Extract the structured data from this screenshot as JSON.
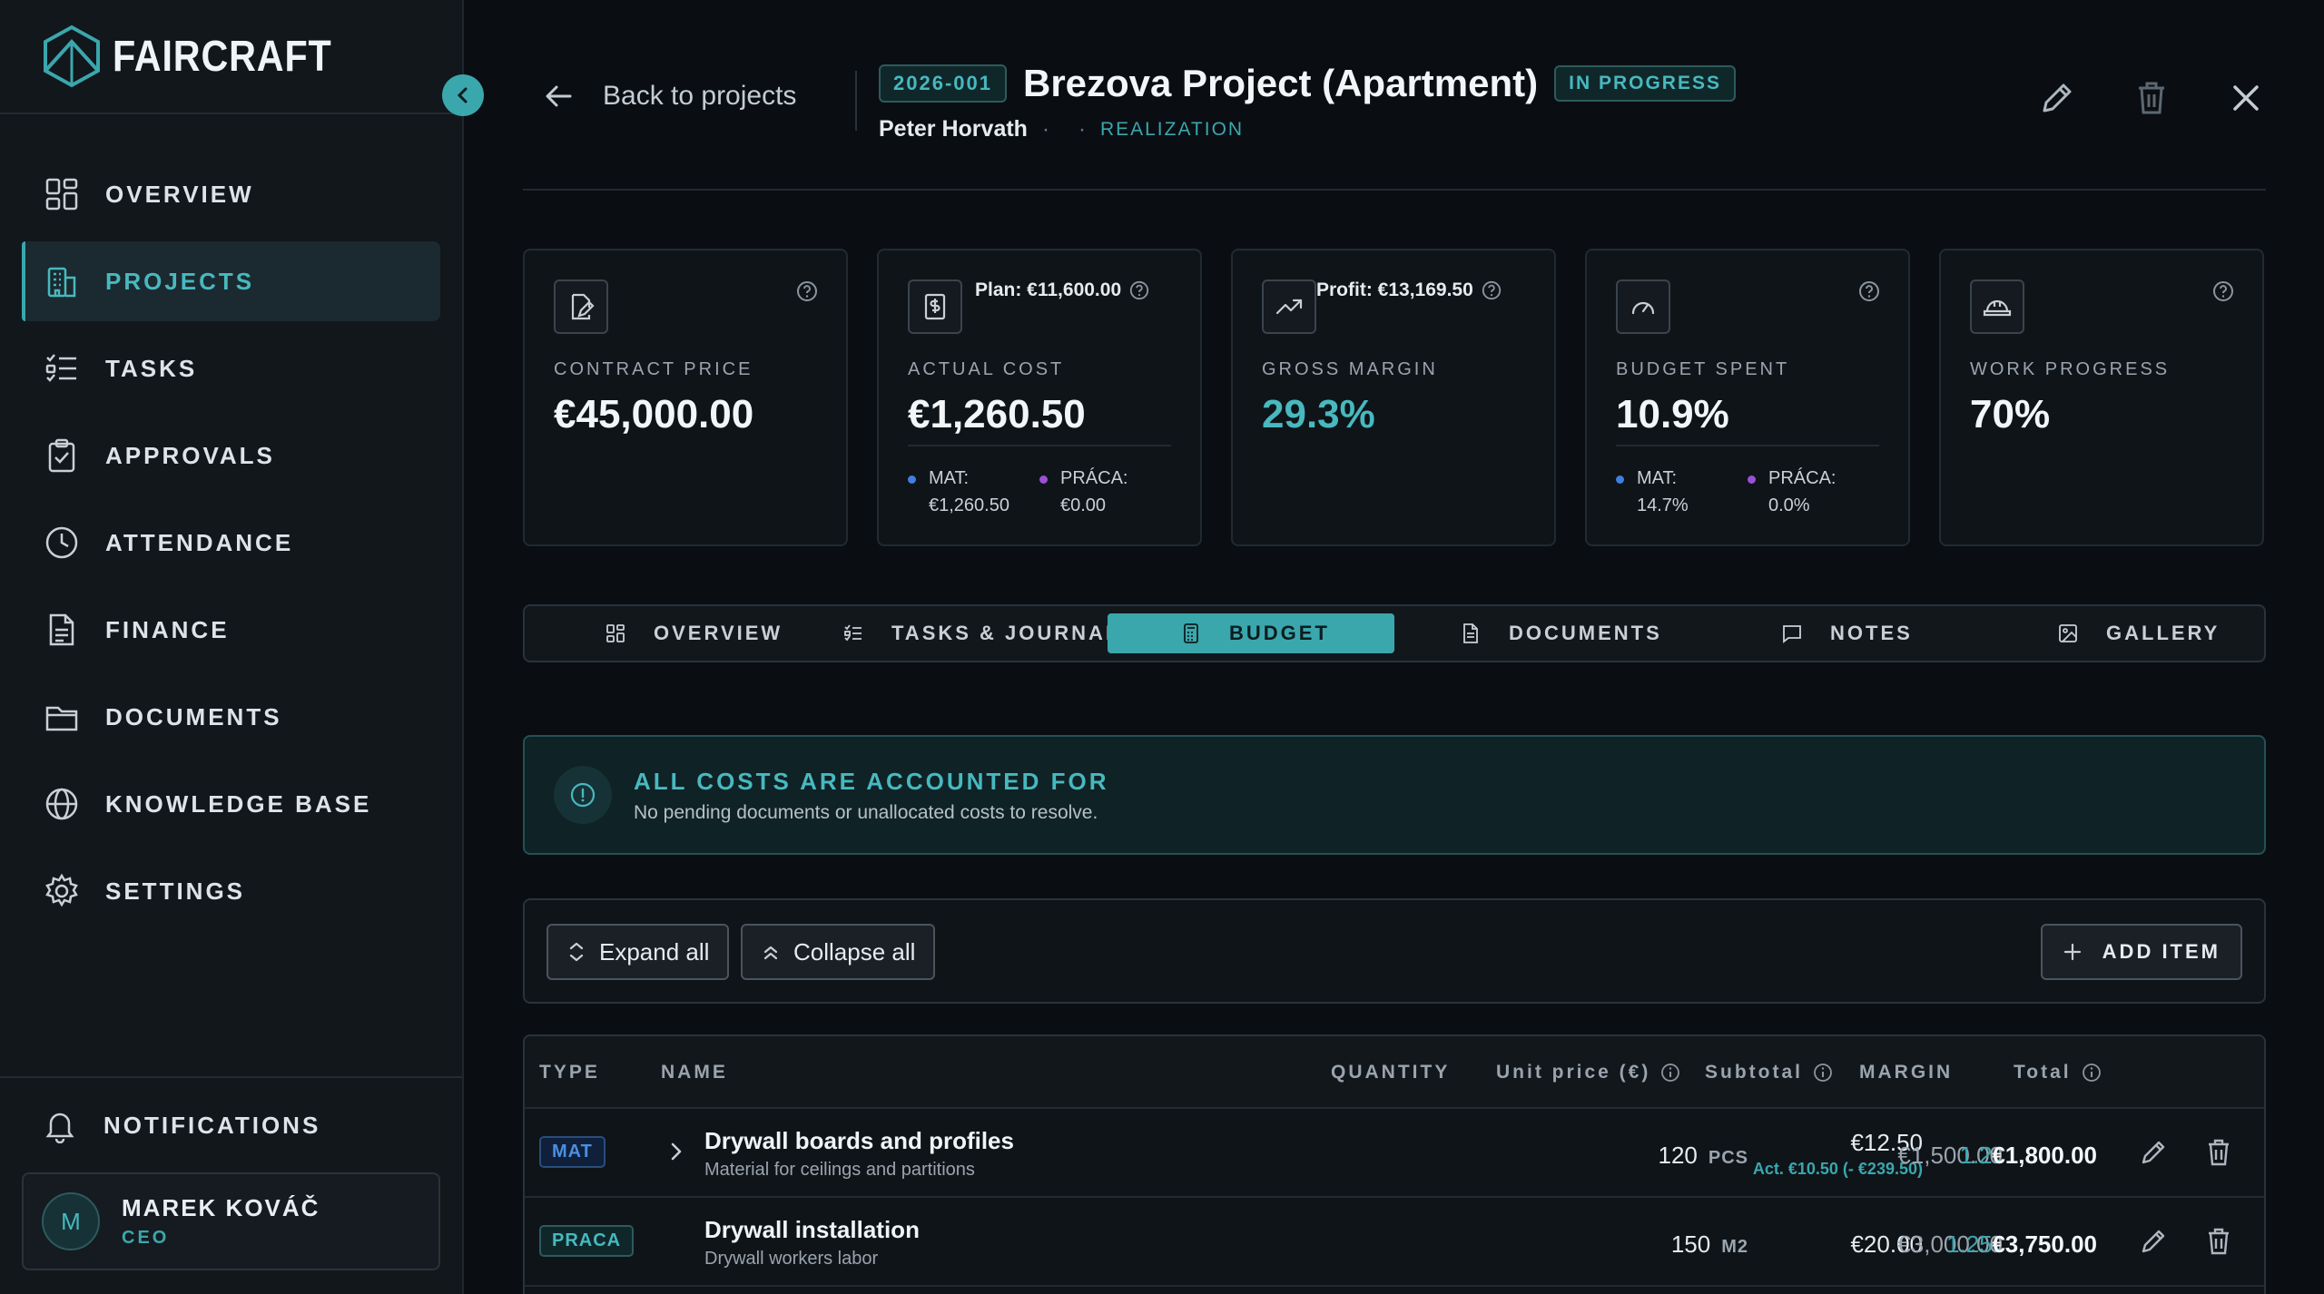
{
  "brand": {
    "name": "FAIRCRAFT"
  },
  "sidebar": {
    "items": [
      {
        "label": "OVERVIEW",
        "icon": "grid-icon"
      },
      {
        "label": "PROJECTS",
        "icon": "building-icon",
        "active": true
      },
      {
        "label": "TASKS",
        "icon": "checklist-icon"
      },
      {
        "label": "APPROVALS",
        "icon": "clipboard-check-icon"
      },
      {
        "label": "ATTENDANCE",
        "icon": "clock-icon"
      },
      {
        "label": "FINANCE",
        "icon": "document-icon"
      },
      {
        "label": "DOCUMENTS",
        "icon": "folder-icon"
      },
      {
        "label": "KNOWLEDGE BASE",
        "icon": "globe-icon"
      },
      {
        "label": "SETTINGS",
        "icon": "gear-icon"
      }
    ],
    "notifications_label": "NOTIFICATIONS",
    "user": {
      "initial": "M",
      "name": "MAREK KOVÁČ",
      "role": "CEO"
    }
  },
  "header": {
    "back_label": "Back to projects",
    "code": "2026-001",
    "title": "Brezova Project (Apartment)",
    "status": "IN PROGRESS",
    "client": "Peter Horvath",
    "phase": "REALIZATION"
  },
  "cards": [
    {
      "label": "CONTRACT PRICE",
      "value": "€45,000.00",
      "icon": "contract-edit-icon"
    },
    {
      "label": "ACTUAL COST",
      "value": "€1,260.50",
      "extra": "Plan: €11,600.00",
      "icon": "dollar-doc-icon",
      "split": [
        {
          "name": "MAT:",
          "value": "€1,260.50",
          "color": "#3f7fe0"
        },
        {
          "name": "PRÁCA:",
          "value": "€0.00",
          "color": "#9b4fd6"
        }
      ]
    },
    {
      "label": "GROSS MARGIN",
      "value": "29.3%",
      "extra": "Profit: €13,169.50",
      "icon": "trend-up-icon"
    },
    {
      "label": "BUDGET SPENT",
      "value": "10.9%",
      "icon": "gauge-icon",
      "split": [
        {
          "name": "MAT:",
          "value": "14.7%",
          "color": "#3f7fe0"
        },
        {
          "name": "PRÁCA:",
          "value": "0.0%",
          "color": "#9b4fd6"
        }
      ]
    },
    {
      "label": "WORK PROGRESS",
      "value": "70%",
      "icon": "hard-hat-icon"
    }
  ],
  "tabs": [
    {
      "label": "OVERVIEW",
      "icon": "grid-icon"
    },
    {
      "label": "TASKS & JOURNAL",
      "icon": "checklist-icon"
    },
    {
      "label": "BUDGET",
      "icon": "calculator-icon",
      "active": true
    },
    {
      "label": "DOCUMENTS",
      "icon": "document-icon"
    },
    {
      "label": "NOTES",
      "icon": "message-icon"
    },
    {
      "label": "GALLERY",
      "icon": "image-icon"
    }
  ],
  "banner": {
    "title": "ALL COSTS ARE ACCOUNTED FOR",
    "text": "No pending documents or unallocated costs to resolve."
  },
  "toolbar": {
    "expand_label": "Expand all",
    "collapse_label": "Collapse all",
    "add_label": "ADD ITEM"
  },
  "table": {
    "columns": {
      "type": "TYPE",
      "name": "NAME",
      "quantity": "QUANTITY",
      "unit_price": "Unit price (€)",
      "subtotal": "Subtotal",
      "margin": "MARGIN",
      "total": "Total"
    },
    "rows": [
      {
        "type": "MAT",
        "name": "Drywall boards and profiles",
        "desc": "Material for ceilings and partitions",
        "qty": "120",
        "unit": "PCS",
        "unit_price": "€12.50",
        "actual": "Act. €10.50 (- €239.50)",
        "subtotal": "€1,500.00",
        "margin": "1.2",
        "total": "€1,800.00"
      },
      {
        "type": "PRACA",
        "name": "Drywall installation",
        "desc": "Drywall workers labor",
        "qty": "150",
        "unit": "M2",
        "unit_price": "€20.00",
        "subtotal": "€3,000.00",
        "margin": "1.25",
        "total": "€3,750.00"
      }
    ]
  }
}
